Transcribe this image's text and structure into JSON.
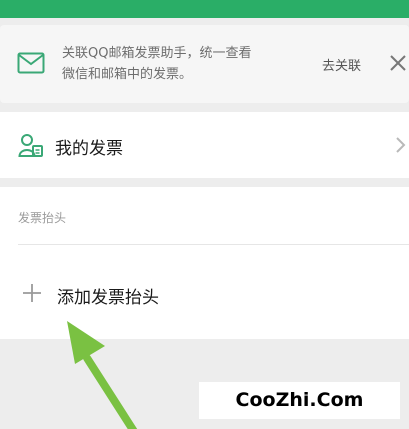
{
  "banner": {
    "icon": "mail-icon",
    "text_line1": "关联QQ邮箱发票助手，统一查看",
    "text_line2": "微信和邮箱中的发票。",
    "link_label": "去关联",
    "close_icon": "close-icon"
  },
  "my_invoice": {
    "icon": "person-card-icon",
    "label": "我的发票",
    "chevron_icon": "chevron-right-icon"
  },
  "invoice_header": {
    "caption": "发票抬头",
    "add_icon": "plus-icon",
    "add_label": "添加发票抬头"
  },
  "annotation": {
    "arrow_icon": "arrow-up-icon",
    "arrow_color": "#7ac142"
  },
  "watermark": {
    "text": "CooZhi.Com"
  },
  "colors": {
    "brand_green": "#2aae67",
    "icon_green": "#3aa876",
    "background": "#ededed"
  }
}
